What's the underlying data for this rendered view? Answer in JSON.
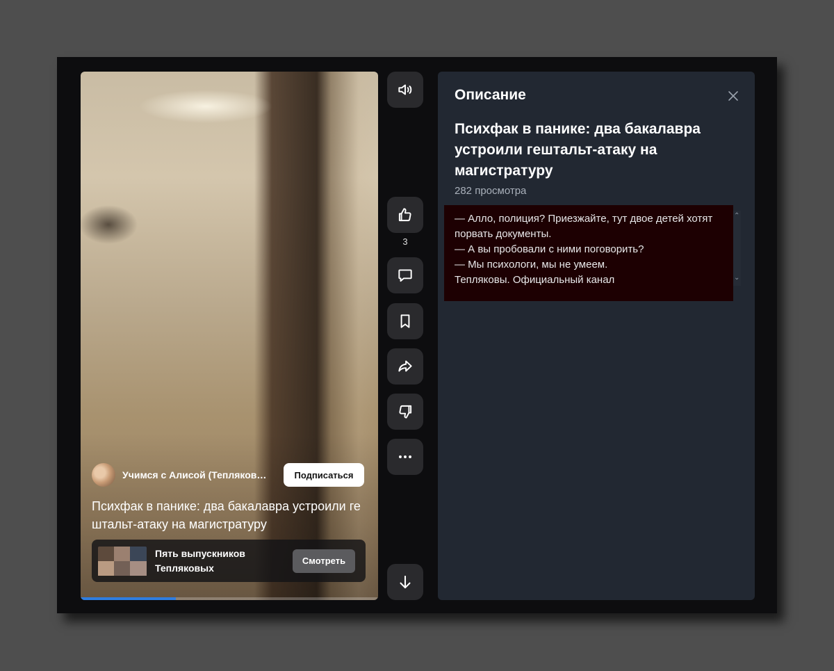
{
  "video": {
    "channel_name": "Учимся с Алисой (Тепляковы. …",
    "subscribe_label": "Подписаться",
    "title": "Психфак в панике: два бакалавра устроили гештальт-атаку на магистратуру",
    "playlist": {
      "title": "Пять выпускников Тепляковых",
      "watch_label": "Смотреть"
    },
    "progress_fraction": 0.32,
    "progress_color": "#2e7de1"
  },
  "actions": {
    "volume_icon": "speaker-icon",
    "like_icon": "thumbs-up-icon",
    "like_count": "3",
    "comment_icon": "comment-icon",
    "bookmark_icon": "bookmark-icon",
    "share_icon": "share-arrow-icon",
    "dislike_icon": "thumbs-down-icon",
    "more_icon": "more-dots-icon",
    "next_icon": "arrow-down-icon"
  },
  "panel": {
    "heading": "Описание",
    "close_icon": "close-icon",
    "title": "Психфак в панике: два бакалавра устроили гештальт-атаку на магистратуру",
    "views": "282 просмотра",
    "description_lines": [
      "— Алло, полиция? Приезжайте, тут двое детей хотят порвать документы.",
      "— А вы пробовали с ними поговорить?",
      "— Мы психологи, мы не умеем.",
      "Тепляковы. Официальный канал"
    ]
  }
}
